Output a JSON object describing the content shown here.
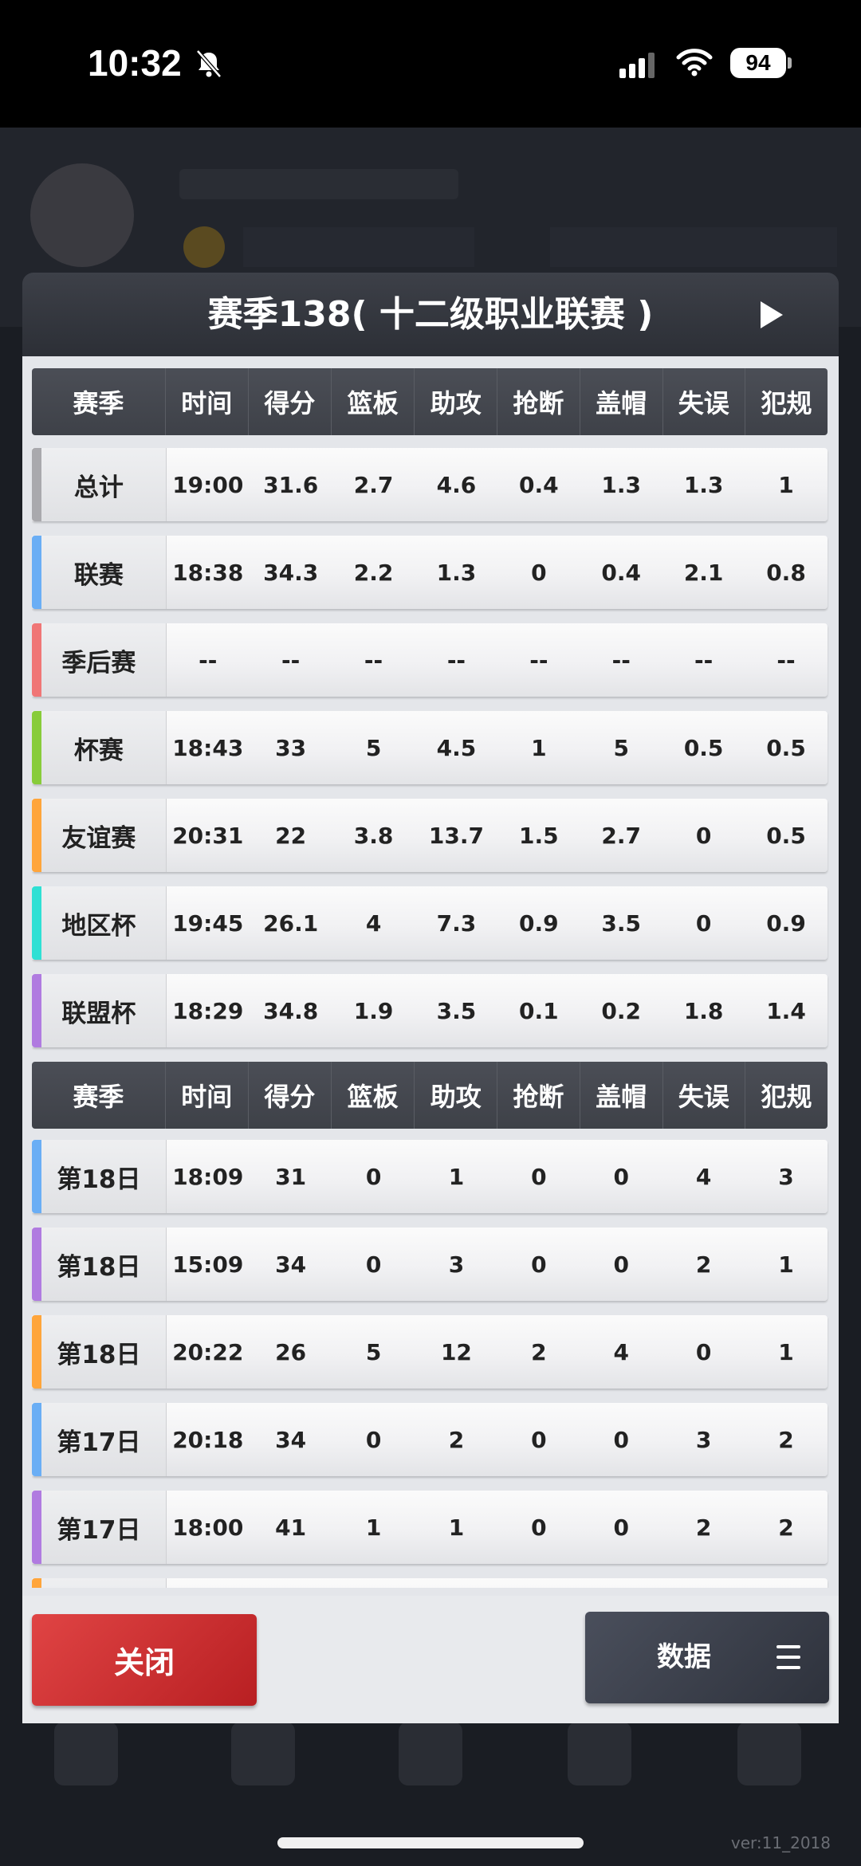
{
  "status_bar": {
    "time": "10:32",
    "battery": "94"
  },
  "panel": {
    "title": "赛季138( 十二级职业联赛 )"
  },
  "columns": [
    "赛季",
    "时间",
    "得分",
    "篮板",
    "助攻",
    "抢断",
    "盖帽",
    "失误",
    "犯规"
  ],
  "summary_rows": [
    {
      "color": "#a9a9ad",
      "cells": [
        "总计",
        "19:00",
        "31.6",
        "2.7",
        "4.6",
        "0.4",
        "1.3",
        "1.3",
        "1"
      ]
    },
    {
      "color": "#6aaef5",
      "cells": [
        "联赛",
        "18:38",
        "34.3",
        "2.2",
        "1.3",
        "0",
        "0.4",
        "2.1",
        "0.8"
      ]
    },
    {
      "color": "#f07676",
      "cells": [
        "季后赛",
        "--",
        "--",
        "--",
        "--",
        "--",
        "--",
        "--",
        "--"
      ]
    },
    {
      "color": "#88cc3a",
      "cells": [
        "杯赛",
        "18:43",
        "33",
        "5",
        "4.5",
        "1",
        "5",
        "0.5",
        "0.5"
      ]
    },
    {
      "color": "#ffa53b",
      "cells": [
        "友谊赛",
        "20:31",
        "22",
        "3.8",
        "13.7",
        "1.5",
        "2.7",
        "0",
        "0.5"
      ]
    },
    {
      "color": "#2fe0d4",
      "cells": [
        "地区杯",
        "19:45",
        "26.1",
        "4",
        "7.3",
        "0.9",
        "3.5",
        "0",
        "0.9"
      ]
    },
    {
      "color": "#b07be0",
      "cells": [
        "联盟杯",
        "18:29",
        "34.8",
        "1.9",
        "3.5",
        "0.1",
        "0.2",
        "1.8",
        "1.4"
      ]
    }
  ],
  "game_rows": [
    {
      "color": "#6aaef5",
      "cells": [
        "第18日",
        "18:09",
        "31",
        "0",
        "1",
        "0",
        "0",
        "4",
        "3"
      ]
    },
    {
      "color": "#b07be0",
      "cells": [
        "第18日",
        "15:09",
        "34",
        "0",
        "3",
        "0",
        "0",
        "2",
        "1"
      ]
    },
    {
      "color": "#ffa53b",
      "cells": [
        "第18日",
        "20:22",
        "26",
        "5",
        "12",
        "2",
        "4",
        "0",
        "1"
      ]
    },
    {
      "color": "#6aaef5",
      "cells": [
        "第17日",
        "20:18",
        "34",
        "0",
        "2",
        "0",
        "0",
        "3",
        "2"
      ]
    },
    {
      "color": "#b07be0",
      "cells": [
        "第17日",
        "18:00",
        "41",
        "1",
        "1",
        "0",
        "0",
        "2",
        "2"
      ]
    },
    {
      "color": "#ffa53b",
      "cells": [
        "",
        "",
        "",
        "",
        "",
        "",
        "",
        "",
        ""
      ]
    }
  ],
  "buttons": {
    "close": "关闭",
    "data": "数据"
  },
  "footer": {
    "version": "ver:11_2018"
  }
}
